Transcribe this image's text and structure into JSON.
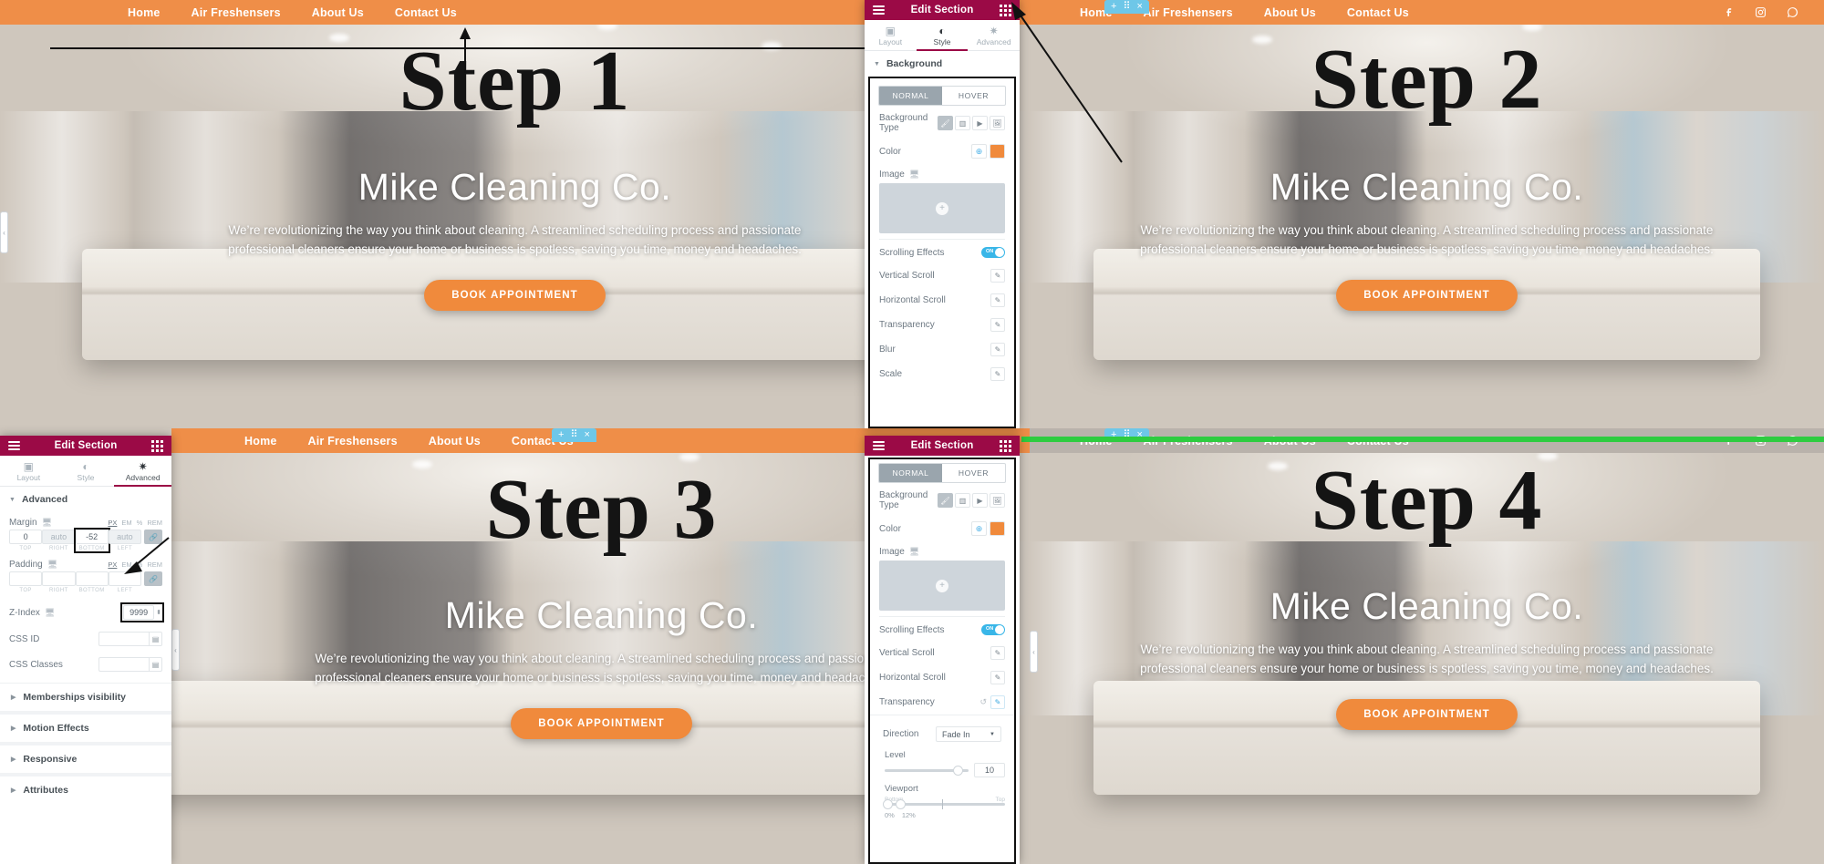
{
  "site": {
    "nav": [
      "Home",
      "Air Freshensers",
      "About Us",
      "Contact Us"
    ],
    "nav_items": [
      {
        "label": "Home"
      },
      {
        "label": "Air Freshensers"
      },
      {
        "label": "About Us"
      },
      {
        "label": "Contact Us"
      }
    ],
    "social": [
      "facebook-icon",
      "instagram-icon",
      "whatsapp-icon"
    ],
    "heading": "Mike Cleaning Co.",
    "paragraph": "We’re revolutionizing the way you think about cleaning. A streamlined scheduling process and passionate professional cleaners ensure your home or business is spotless, saving you time, money and headaches.",
    "cta": "BOOK APPOINTMENT"
  },
  "steps": [
    {
      "label": "Step 1"
    },
    {
      "label": "Step 2"
    },
    {
      "label": "Step 3"
    },
    {
      "label": "Step 4"
    }
  ],
  "section_toolbar": {
    "add": "+",
    "handle": "⠿",
    "close": "×"
  },
  "panel_style": {
    "title": "Edit Section",
    "tabs": [
      {
        "label": "Layout",
        "icon": "layout-icon",
        "active": false
      },
      {
        "label": "Style",
        "icon": "style-contrast-icon",
        "active": true
      },
      {
        "label": "Advanced",
        "icon": "gear-icon",
        "active": false
      }
    ],
    "section_title": "Background",
    "state_tabs": [
      {
        "label": "NORMAL",
        "active": true
      },
      {
        "label": "HOVER",
        "active": false
      }
    ],
    "background_type_label": "Background Type",
    "background_type_options": [
      "classic-brush-icon",
      "gradient-icon",
      "video-icon",
      "slideshow-icon"
    ],
    "background_type_selected": 0,
    "color_label": "Color",
    "color_value": "#f08a3c",
    "image_label": "Image",
    "scrolling_effects_label": "Scrolling Effects",
    "scrolling_effects_state": "ON",
    "effects": [
      {
        "label": "Vertical Scroll"
      },
      {
        "label": "Horizontal Scroll"
      },
      {
        "label": "Transparency"
      },
      {
        "label": "Blur"
      },
      {
        "label": "Scale"
      }
    ]
  },
  "panel_advanced": {
    "title": "Edit Section",
    "tabs": [
      {
        "label": "Layout",
        "icon": "layout-icon",
        "active": false
      },
      {
        "label": "Style",
        "icon": "style-contrast-icon",
        "active": false
      },
      {
        "label": "Advanced",
        "icon": "gear-icon",
        "active": true
      }
    ],
    "section_title": "Advanced",
    "margin_label": "Margin",
    "units": [
      "PX",
      "EM",
      "%",
      "REM"
    ],
    "unit_selected": "PX",
    "margin_values": [
      "0",
      "auto",
      "-52",
      "auto"
    ],
    "margin_captions": [
      "TOP",
      "RIGHT",
      "BOTTOM",
      "LEFT"
    ],
    "padding_label": "Padding",
    "padding_values": [
      "",
      "",
      "",
      ""
    ],
    "padding_captions": [
      "TOP",
      "RIGHT",
      "BOTTOM",
      "LEFT"
    ],
    "z_index_label": "Z-Index",
    "z_index_value": "9999",
    "css_id_label": "CSS ID",
    "css_id_value": "",
    "css_classes_label": "CSS Classes",
    "css_classes_value": "",
    "accordions": [
      {
        "label": "Memberships visibility"
      },
      {
        "label": "Motion Effects"
      },
      {
        "label": "Responsive"
      },
      {
        "label": "Attributes"
      }
    ]
  },
  "panel_transparency": {
    "title": "Edit Section",
    "state_tabs": [
      {
        "label": "NORMAL",
        "active": true
      },
      {
        "label": "HOVER",
        "active": false
      }
    ],
    "background_type_label": "Background Type",
    "color_label": "Color",
    "color_value": "#f08a3c",
    "image_label": "Image",
    "scrolling_effects_label": "Scrolling Effects",
    "scrolling_effects_state": "ON",
    "effects": [
      {
        "label": "Vertical Scroll"
      },
      {
        "label": "Horizontal Scroll"
      },
      {
        "label": "Transparency"
      }
    ],
    "direction_label": "Direction",
    "direction_value": "Fade In",
    "level_label": "Level",
    "level_value": "10",
    "viewport_label": "Viewport",
    "viewport_bottom_label": "Bottom",
    "viewport_top_label": "Top",
    "viewport_values": [
      "0%",
      "12%"
    ]
  },
  "colors": {
    "brand_orange": "#ef8e48",
    "panel_header": "#9b0a46",
    "toggle_on": "#39b6e8",
    "toolbar_cyan": "#6ec7e8",
    "green_bar": "#2ecc40"
  }
}
